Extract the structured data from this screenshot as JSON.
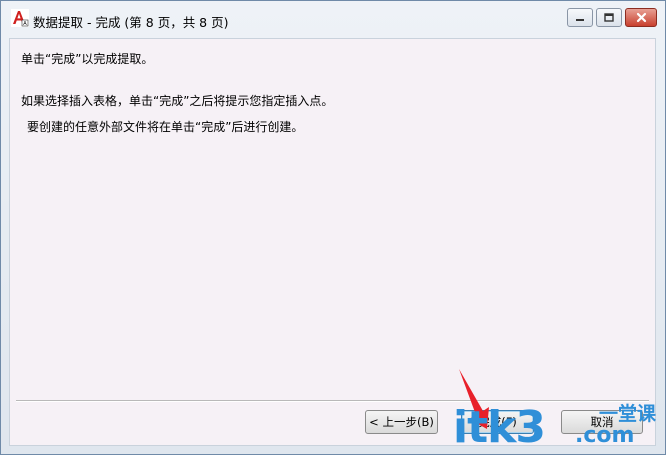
{
  "window": {
    "title": "数据提取 - 完成 (第 8 页，共 8 页)",
    "icon": "autocad-app-icon"
  },
  "content": {
    "line1": "单击“完成”以完成提取。",
    "line2": "如果选择插入表格，单击“完成”之后将提示您指定插入点。",
    "line3": "要创建的任意外部文件将在单击“完成”后进行创建。"
  },
  "buttons": {
    "back": "< 上一步(B)",
    "finish": "完成(F)",
    "cancel": "取消"
  },
  "watermark": {
    "main": "itk3",
    "sub": "一堂课",
    "com": ".com"
  },
  "colors": {
    "watermark": "#2f8fd8",
    "arrow": "#e8202a",
    "close_button": "#c8402e"
  }
}
